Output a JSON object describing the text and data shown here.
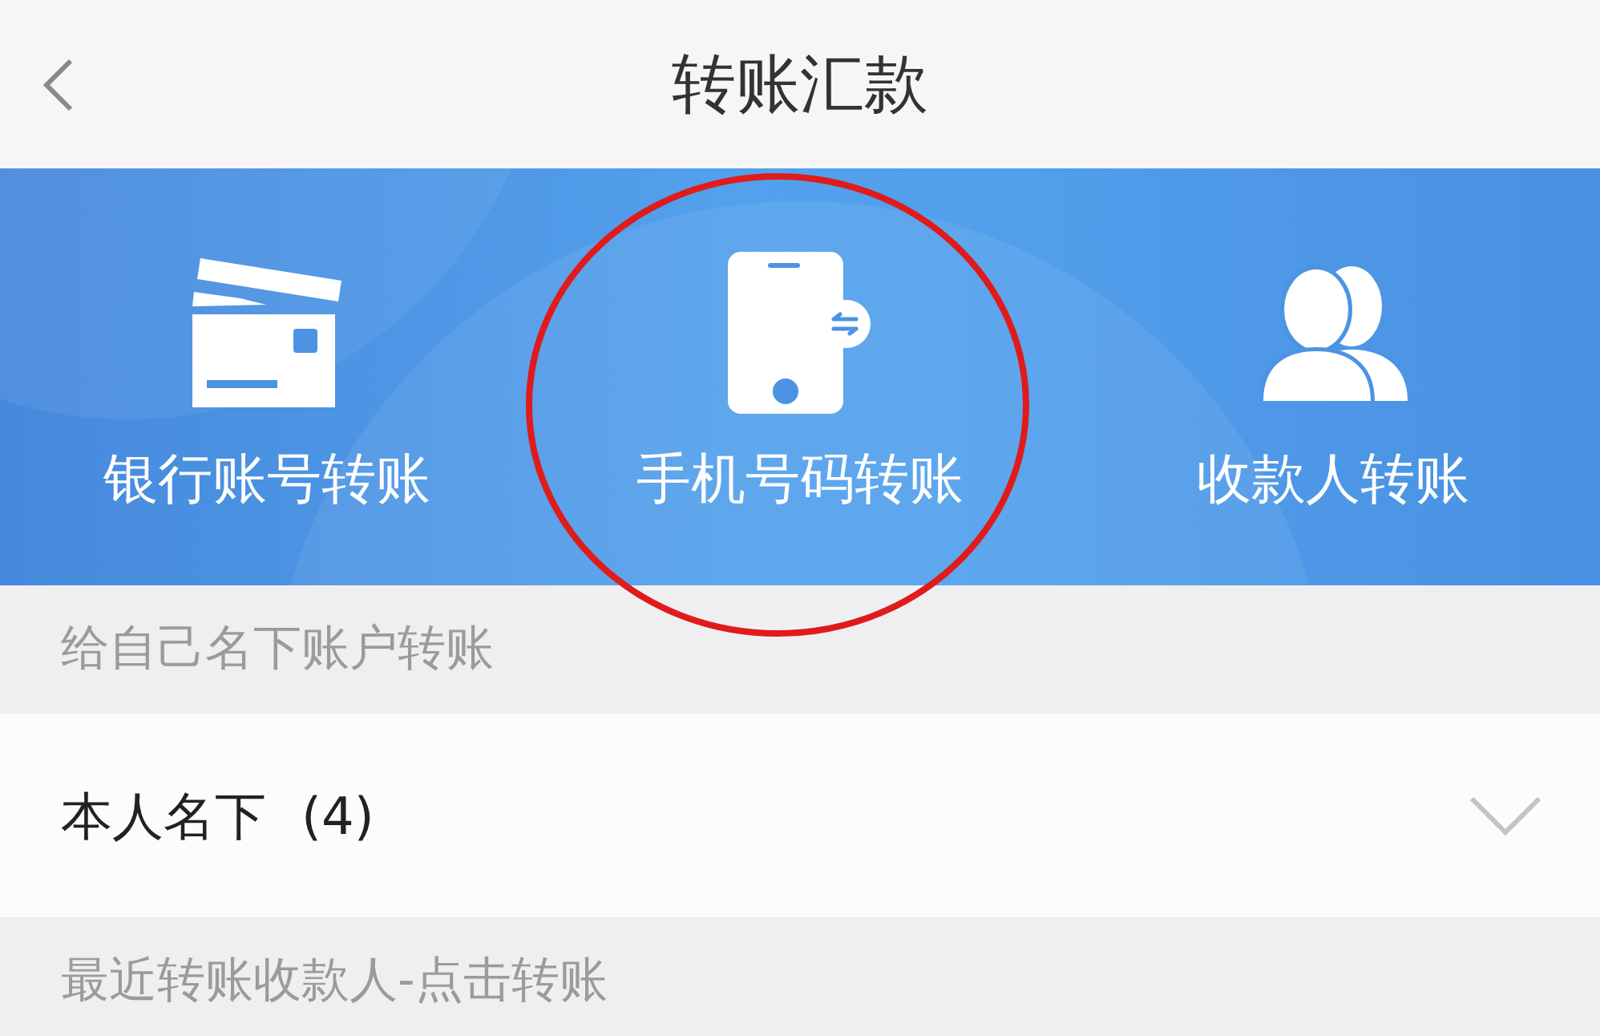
{
  "header": {
    "title": "转账汇款"
  },
  "transfer_options": [
    {
      "label": "银行账号转账",
      "kind": "card",
      "circled": false
    },
    {
      "label": "手机号码转账",
      "kind": "phone",
      "circled": true
    },
    {
      "label": "收款人转账",
      "kind": "people",
      "circled": false
    }
  ],
  "own_accounts": {
    "heading": "给自己名下账户转账",
    "row": {
      "label": "本人名下",
      "count": "(4)",
      "expanded": false
    }
  },
  "recent": {
    "heading": "最近转账收款人-点击转账"
  }
}
